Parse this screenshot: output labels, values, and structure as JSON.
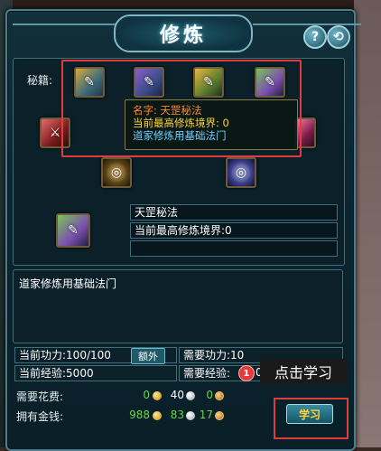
{
  "window": {
    "title": "修炼"
  },
  "controls": {
    "help_label": "?",
    "back_label": "⟲"
  },
  "skills": {
    "label": "秘籍:",
    "slots": [
      {
        "name": "book-1",
        "icon": "scroll-icon"
      },
      {
        "name": "book-2",
        "icon": "scroll-icon"
      },
      {
        "name": "book-3",
        "icon": "scroll-icon"
      },
      {
        "name": "book-4",
        "icon": "scroll-icon"
      }
    ]
  },
  "tooltip": {
    "line1": "名字: 天罡秘法",
    "line2": "当前最高修炼境界: 0",
    "line3": "道家修炼用基础法门"
  },
  "selected": {
    "name": "天罡秘法",
    "realm": "当前最高修炼境界:0",
    "extra": ""
  },
  "description": "道家修炼用基础法门",
  "stats": {
    "current_power": "当前功力:100/100",
    "extra_label": "额外",
    "need_power": "需要功力:10",
    "current_exp": "当前经验:5000",
    "need_exp": "需要经验:",
    "need_exp_tail": "0"
  },
  "cost": {
    "label": "需要花费:",
    "gold": "0",
    "silver": "40",
    "copper": "0"
  },
  "money": {
    "label": "拥有金钱:",
    "gold": "988",
    "silver": "83",
    "copper": "17"
  },
  "guide": {
    "step": "1",
    "hint": "点击学习"
  },
  "learn_button": "学习",
  "colors": {
    "accent": "#4c7d8c",
    "highlight": "#e23b3b",
    "money_green": "#6ad24a"
  }
}
